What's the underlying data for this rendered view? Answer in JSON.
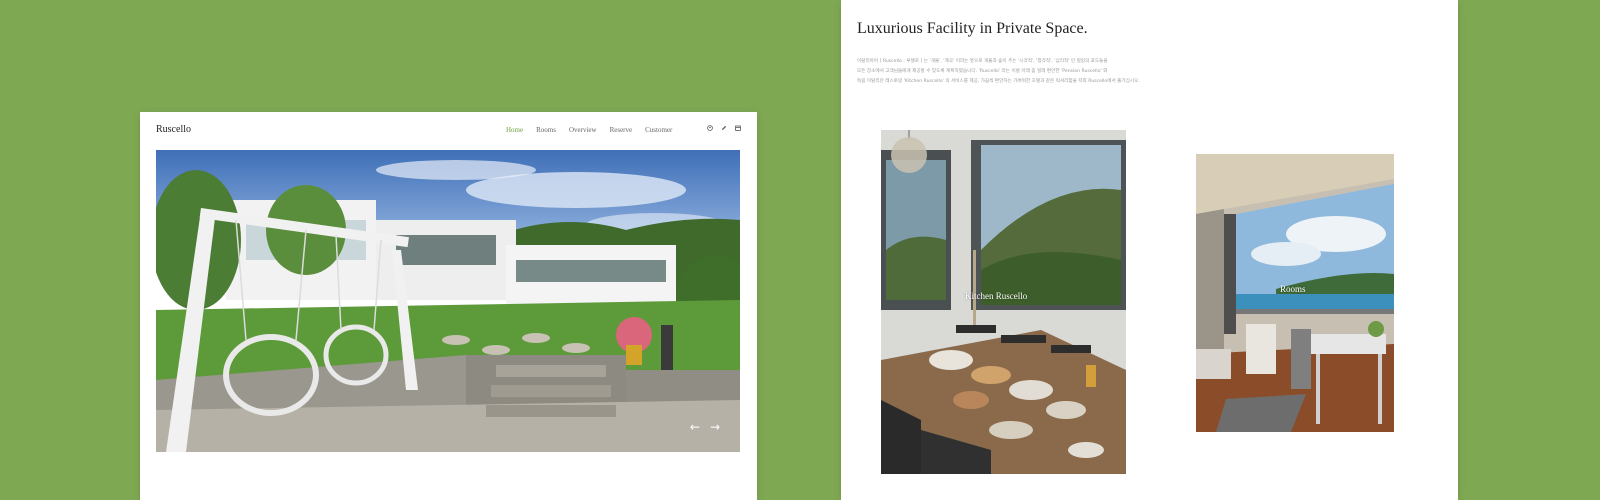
{
  "home_page": {
    "logo": "Ruscello",
    "nav": [
      {
        "label": "Home",
        "active": true
      },
      {
        "label": "Rooms",
        "active": false
      },
      {
        "label": "Overview",
        "active": false
      },
      {
        "label": "Reserve",
        "active": false
      },
      {
        "label": "Customer",
        "active": false
      }
    ],
    "header_icons": [
      "user-icon",
      "pencil-icon",
      "calendar-icon"
    ],
    "hero_image": "garden-swing-villa-photo",
    "arrows": {
      "prev": "←",
      "next": "→"
    }
  },
  "facility_page": {
    "title": "Luxurious Facility in Private Space.",
    "description_lines": [
      "이탈리아어 [ Ruscello : 루쉘로 ] 는 '개울', '계곡' 이라는 뜻으로 개울과 숲이 주는 '시각적', '청각적', '심리적' 인 힐링의 포도들을",
      "모든 장소에서 고객님들에게 제공할 수 있도록 계획하였습니다. 'Ruscello' 라는 이름 아래 좀 힐레 편안한 'Pension Ruscello' 와",
      "독립 이탈리안 레스토랑 'Kitchen Ruscello' 의 서비스를 제공, 가끔씩 편안하는 가벼워한 호텔과 같은 럭셔리함을 저희 Ruscello에서 즐기십시오."
    ],
    "photos": [
      {
        "caption": "Kitchen Ruscello",
        "image": "kitchen-dining-photo"
      },
      {
        "caption": "Rooms",
        "image": "room-balcony-photo"
      }
    ]
  },
  "colors": {
    "background": "#7fa853",
    "nav_active": "#6f9e3f"
  }
}
